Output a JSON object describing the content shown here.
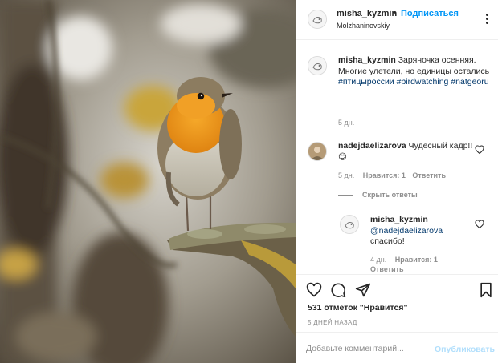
{
  "colors": {
    "accent": "#0095f6",
    "hashtag": "#00376b",
    "muted": "#8e8e8e",
    "publish_disabled": "#b2dffc"
  },
  "post_image": {
    "alt_icon": "photo-robin-on-branch"
  },
  "header": {
    "username": "misha_kyzmin",
    "dot": "•",
    "follow_label": "Подписаться",
    "location": "Molzhaninovskiy",
    "more_icon": "ellipsis-icon"
  },
  "caption": {
    "username": "misha_kyzmin",
    "text": "Заряночка осенняя. Многие улетели, но единицы остались",
    "hashtags": "#птицыроссии #birdwatching #natgeoru",
    "time": "5 дн."
  },
  "comment": {
    "username": "nadejdaelizarova",
    "text": "Чудесный кадр!! 😊",
    "time": "5 дн.",
    "likes": "Нравится: 1",
    "reply": "Ответить",
    "hide_replies": "Скрыть ответы"
  },
  "reply_comment": {
    "username": "misha_kyzmin",
    "mention": "@nadejdaelizarova",
    "text": "спасибо!",
    "time": "4 дн.",
    "likes": "Нравится: 1",
    "reply": "Ответить"
  },
  "actions": {
    "icons": [
      "heart-icon",
      "comment-icon",
      "share-icon",
      "bookmark-icon"
    ],
    "likes_text": "531 отметок \"Нравится\"",
    "date": "5 ДНЕЙ НАЗАД"
  },
  "add_comment": {
    "placeholder": "Добавьте комментарий...",
    "publish_label": "Опубликовать"
  }
}
